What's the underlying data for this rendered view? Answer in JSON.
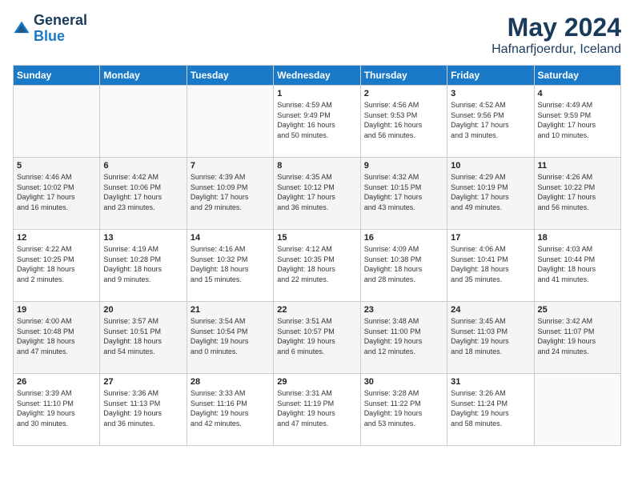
{
  "logo": {
    "general": "General",
    "blue": "Blue"
  },
  "title": "May 2024",
  "subtitle": "Hafnarfjoerdur, Iceland",
  "days_of_week": [
    "Sunday",
    "Monday",
    "Tuesday",
    "Wednesday",
    "Thursday",
    "Friday",
    "Saturday"
  ],
  "weeks": [
    [
      {
        "day": "",
        "info": ""
      },
      {
        "day": "",
        "info": ""
      },
      {
        "day": "",
        "info": ""
      },
      {
        "day": "1",
        "info": "Sunrise: 4:59 AM\nSunset: 9:49 PM\nDaylight: 16 hours\nand 50 minutes."
      },
      {
        "day": "2",
        "info": "Sunrise: 4:56 AM\nSunset: 9:53 PM\nDaylight: 16 hours\nand 56 minutes."
      },
      {
        "day": "3",
        "info": "Sunrise: 4:52 AM\nSunset: 9:56 PM\nDaylight: 17 hours\nand 3 minutes."
      },
      {
        "day": "4",
        "info": "Sunrise: 4:49 AM\nSunset: 9:59 PM\nDaylight: 17 hours\nand 10 minutes."
      }
    ],
    [
      {
        "day": "5",
        "info": "Sunrise: 4:46 AM\nSunset: 10:02 PM\nDaylight: 17 hours\nand 16 minutes."
      },
      {
        "day": "6",
        "info": "Sunrise: 4:42 AM\nSunset: 10:06 PM\nDaylight: 17 hours\nand 23 minutes."
      },
      {
        "day": "7",
        "info": "Sunrise: 4:39 AM\nSunset: 10:09 PM\nDaylight: 17 hours\nand 29 minutes."
      },
      {
        "day": "8",
        "info": "Sunrise: 4:35 AM\nSunset: 10:12 PM\nDaylight: 17 hours\nand 36 minutes."
      },
      {
        "day": "9",
        "info": "Sunrise: 4:32 AM\nSunset: 10:15 PM\nDaylight: 17 hours\nand 43 minutes."
      },
      {
        "day": "10",
        "info": "Sunrise: 4:29 AM\nSunset: 10:19 PM\nDaylight: 17 hours\nand 49 minutes."
      },
      {
        "day": "11",
        "info": "Sunrise: 4:26 AM\nSunset: 10:22 PM\nDaylight: 17 hours\nand 56 minutes."
      }
    ],
    [
      {
        "day": "12",
        "info": "Sunrise: 4:22 AM\nSunset: 10:25 PM\nDaylight: 18 hours\nand 2 minutes."
      },
      {
        "day": "13",
        "info": "Sunrise: 4:19 AM\nSunset: 10:28 PM\nDaylight: 18 hours\nand 9 minutes."
      },
      {
        "day": "14",
        "info": "Sunrise: 4:16 AM\nSunset: 10:32 PM\nDaylight: 18 hours\nand 15 minutes."
      },
      {
        "day": "15",
        "info": "Sunrise: 4:12 AM\nSunset: 10:35 PM\nDaylight: 18 hours\nand 22 minutes."
      },
      {
        "day": "16",
        "info": "Sunrise: 4:09 AM\nSunset: 10:38 PM\nDaylight: 18 hours\nand 28 minutes."
      },
      {
        "day": "17",
        "info": "Sunrise: 4:06 AM\nSunset: 10:41 PM\nDaylight: 18 hours\nand 35 minutes."
      },
      {
        "day": "18",
        "info": "Sunrise: 4:03 AM\nSunset: 10:44 PM\nDaylight: 18 hours\nand 41 minutes."
      }
    ],
    [
      {
        "day": "19",
        "info": "Sunrise: 4:00 AM\nSunset: 10:48 PM\nDaylight: 18 hours\nand 47 minutes."
      },
      {
        "day": "20",
        "info": "Sunrise: 3:57 AM\nSunset: 10:51 PM\nDaylight: 18 hours\nand 54 minutes."
      },
      {
        "day": "21",
        "info": "Sunrise: 3:54 AM\nSunset: 10:54 PM\nDaylight: 19 hours\nand 0 minutes."
      },
      {
        "day": "22",
        "info": "Sunrise: 3:51 AM\nSunset: 10:57 PM\nDaylight: 19 hours\nand 6 minutes."
      },
      {
        "day": "23",
        "info": "Sunrise: 3:48 AM\nSunset: 11:00 PM\nDaylight: 19 hours\nand 12 minutes."
      },
      {
        "day": "24",
        "info": "Sunrise: 3:45 AM\nSunset: 11:03 PM\nDaylight: 19 hours\nand 18 minutes."
      },
      {
        "day": "25",
        "info": "Sunrise: 3:42 AM\nSunset: 11:07 PM\nDaylight: 19 hours\nand 24 minutes."
      }
    ],
    [
      {
        "day": "26",
        "info": "Sunrise: 3:39 AM\nSunset: 11:10 PM\nDaylight: 19 hours\nand 30 minutes."
      },
      {
        "day": "27",
        "info": "Sunrise: 3:36 AM\nSunset: 11:13 PM\nDaylight: 19 hours\nand 36 minutes."
      },
      {
        "day": "28",
        "info": "Sunrise: 3:33 AM\nSunset: 11:16 PM\nDaylight: 19 hours\nand 42 minutes."
      },
      {
        "day": "29",
        "info": "Sunrise: 3:31 AM\nSunset: 11:19 PM\nDaylight: 19 hours\nand 47 minutes."
      },
      {
        "day": "30",
        "info": "Sunrise: 3:28 AM\nSunset: 11:22 PM\nDaylight: 19 hours\nand 53 minutes."
      },
      {
        "day": "31",
        "info": "Sunrise: 3:26 AM\nSunset: 11:24 PM\nDaylight: 19 hours\nand 58 minutes."
      },
      {
        "day": "",
        "info": ""
      }
    ]
  ]
}
